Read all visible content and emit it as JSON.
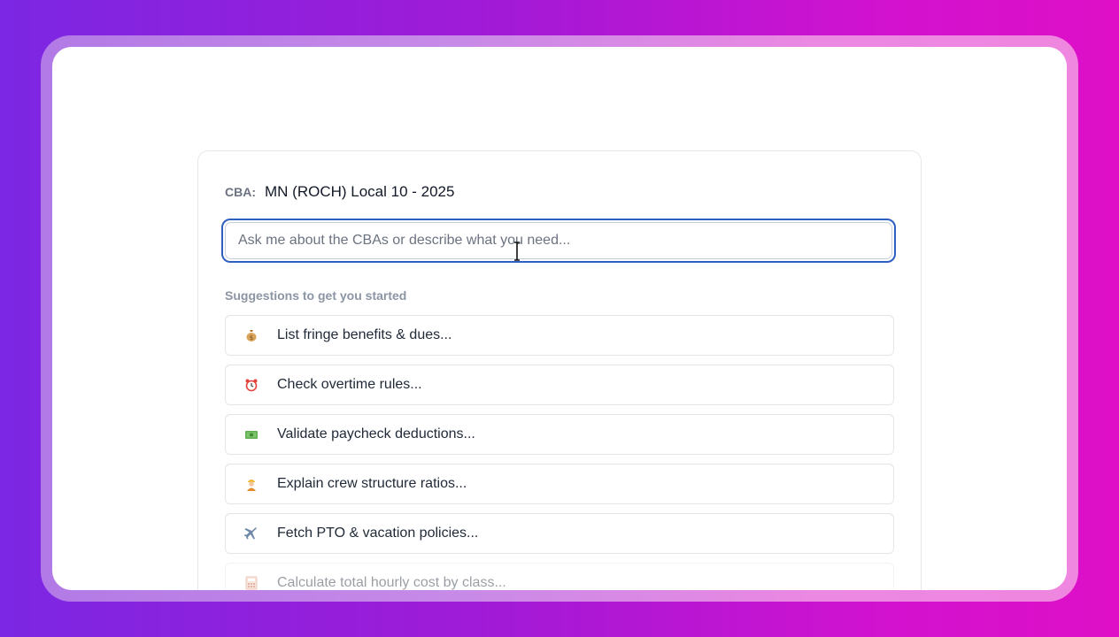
{
  "cba": {
    "label": "CBA:",
    "value": "MN (ROCH) Local 10 - 2025"
  },
  "chat": {
    "placeholder": "Ask me about the CBAs or describe what you need..."
  },
  "suggestions_title": "Suggestions to get you started",
  "suggestions": [
    {
      "icon": "money-bag-icon",
      "label": "List fringe benefits & dues..."
    },
    {
      "icon": "alarm-clock-icon",
      "label": "Check overtime rules..."
    },
    {
      "icon": "banknote-icon",
      "label": "Validate paycheck deductions..."
    },
    {
      "icon": "construction-worker-icon",
      "label": "Explain crew structure ratios..."
    },
    {
      "icon": "airplane-icon",
      "label": "Fetch PTO & vacation policies..."
    },
    {
      "icon": "calculator-icon",
      "label": "Calculate total hourly cost by class..."
    }
  ],
  "colors": {
    "focus_ring": "#2f5fbf",
    "gradient_start": "#7b27e3",
    "gradient_end": "#de0fc6"
  }
}
